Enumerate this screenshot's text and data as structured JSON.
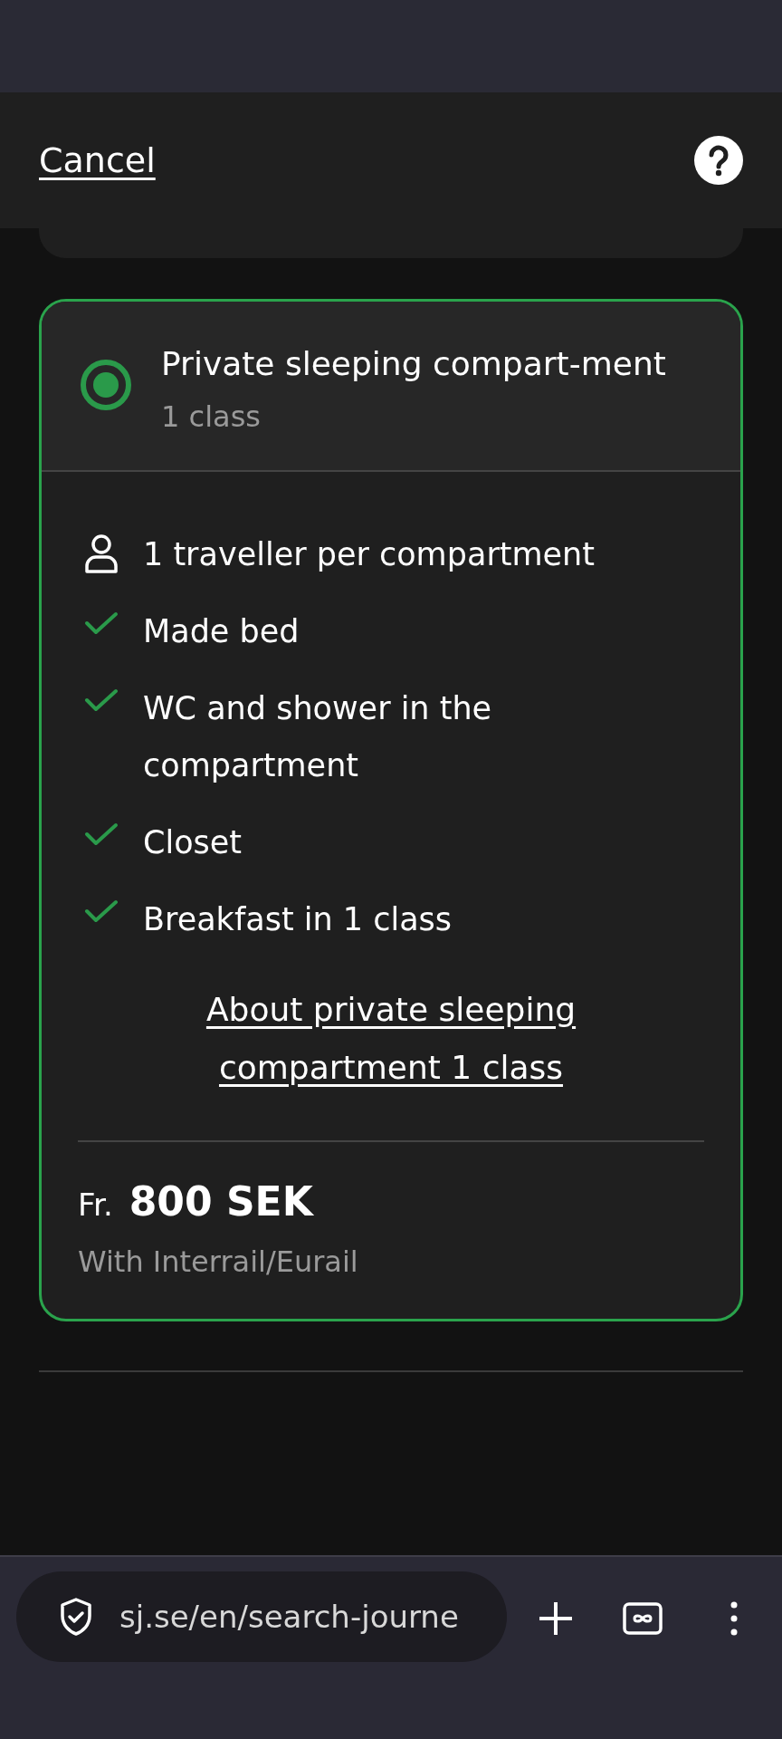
{
  "header": {
    "cancel": "Cancel"
  },
  "option": {
    "selected": true,
    "title": "Private sleeping compart-ment",
    "subtitle": "1 class",
    "features": [
      {
        "kind": "person",
        "text": "1 traveller per compartment"
      },
      {
        "kind": "check",
        "text": "Made bed"
      },
      {
        "kind": "check",
        "text": "WC and shower in the compartment"
      },
      {
        "kind": "check",
        "text": "Closet"
      },
      {
        "kind": "check",
        "text": "Breakfast in 1 class"
      }
    ],
    "link": "About private sleeping compartment 1 class",
    "price_prefix": "Fr.",
    "price": "800 SEK",
    "price_note": "With Interrail/Eurail"
  },
  "browser": {
    "url": "sj.se/en/search-journe"
  }
}
